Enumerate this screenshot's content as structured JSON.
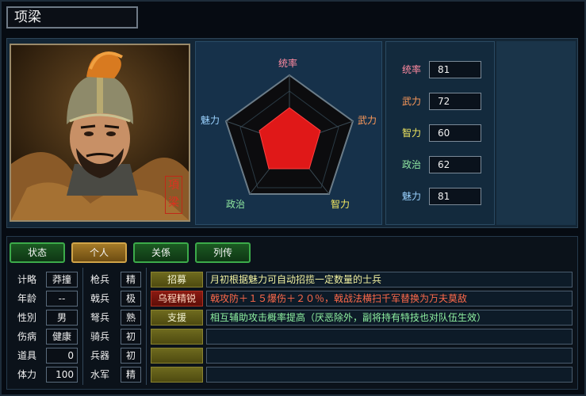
{
  "title": "项梁",
  "portrait_seal": "項梁",
  "radar": {
    "top": "统率",
    "right": "武力",
    "bottom_right": "智力",
    "bottom_left": "政治",
    "left": "魅力"
  },
  "stats": [
    {
      "label": "统率",
      "value": "81",
      "color": "#ff8aa0"
    },
    {
      "label": "武力",
      "value": "72",
      "color": "#ff9a5a"
    },
    {
      "label": "智力",
      "value": "60",
      "color": "#f2e860"
    },
    {
      "label": "政治",
      "value": "62",
      "color": "#8ee6a0"
    },
    {
      "label": "魅力",
      "value": "81",
      "color": "#9ad2ff"
    }
  ],
  "tabs": [
    "状态",
    "个人",
    "关係",
    "列传"
  ],
  "active_tab": "个人",
  "info_left": [
    {
      "label": "计略",
      "value": "莽撞"
    },
    {
      "label": "年龄",
      "value": "--"
    },
    {
      "label": "性別",
      "value": "男"
    },
    {
      "label": "伤病",
      "value": "健康"
    },
    {
      "label": "道具",
      "value": "0"
    },
    {
      "label": "体力",
      "value": "100"
    }
  ],
  "info_troops": [
    {
      "label": "枪兵",
      "value": "精"
    },
    {
      "label": "戟兵",
      "value": "极"
    },
    {
      "label": "弩兵",
      "value": "熟"
    },
    {
      "label": "骑兵",
      "value": "初"
    },
    {
      "label": "兵器",
      "value": "初"
    },
    {
      "label": "水军",
      "value": "精"
    }
  ],
  "skills": [
    {
      "name": "招募",
      "desc": "月初根据魅力可自动招揽一定数量的士兵",
      "name_style": "normal",
      "desc_color": "#f2f2a0"
    },
    {
      "name": "乌程精锐",
      "desc": "戟攻防＋１５爆伤＋２０％，戟战法横扫千军替换为万夫莫敌",
      "name_style": "red",
      "desc_color": "#ff6a4a"
    },
    {
      "name": "支援",
      "desc": "相互辅助攻击概率提高（厌恶除外，副将持有特技也对队伍生效）",
      "name_style": "normal",
      "desc_color": "#8ef0a0"
    },
    {
      "name": "",
      "desc": "",
      "name_style": "normal",
      "desc_color": "#ffffff"
    },
    {
      "name": "",
      "desc": "",
      "name_style": "normal",
      "desc_color": "#ffffff"
    },
    {
      "name": "",
      "desc": "",
      "name_style": "normal",
      "desc_color": "#ffffff"
    }
  ]
}
